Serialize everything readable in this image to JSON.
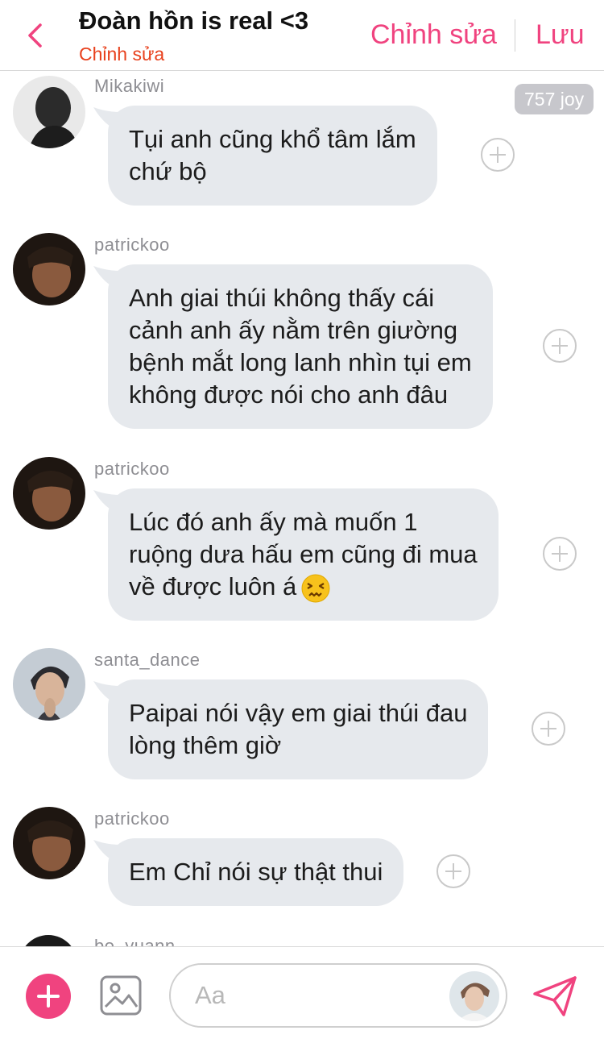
{
  "header": {
    "title": "Đoàn hồn is real <3",
    "subtitle": "Chỉnh sửa",
    "edit_label": "Chỉnh sửa",
    "save_label": "Lưu",
    "accent_color": "#f0437f",
    "subtitle_color": "#e8401c",
    "back_icon": "chevron-left-icon"
  },
  "messages": [
    {
      "username": "Mikakiwi",
      "lines": [
        "Tụi anh cũng khổ tâm lắm",
        "chứ bộ"
      ],
      "badge": "757 joy"
    },
    {
      "username": "patrickoo",
      "lines": [
        "Anh giai thúi không thấy cái",
        "cảnh anh ấy nằm trên giường",
        "bệnh mắt long lanh nhìn tụi em",
        "không được nói cho anh đâu"
      ]
    },
    {
      "username": "patrickoo",
      "lines": [
        "Lúc đó anh ấy mà muốn 1",
        "ruộng dưa hấu em cũng đi mua",
        "về được luôn á"
      ],
      "emoji": "confounded-face-emoji"
    },
    {
      "username": "santa_dance",
      "lines": [
        "Paipai nói vậy em giai thúi đau",
        "lòng thêm giờ"
      ]
    },
    {
      "username": "patrickoo",
      "lines": [
        "Em Chỉ nói sự thật thui"
      ]
    },
    {
      "username": "bo_yuann"
    }
  ],
  "composer": {
    "placeholder": "Aa",
    "add_icon": "plus-circle-icon",
    "image_icon": "image-icon",
    "send_icon": "send-icon"
  },
  "colors": {
    "bubble": "#e6e9ed",
    "username": "#8e8e93",
    "badge": "#c7c7cc"
  }
}
